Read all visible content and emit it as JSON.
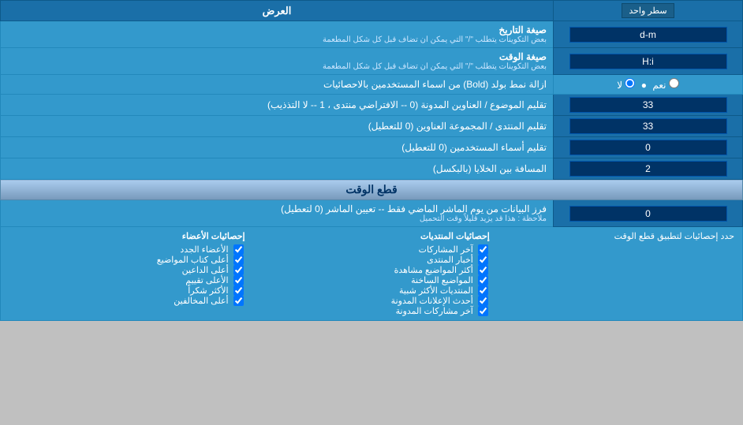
{
  "header": {
    "title": "العرض",
    "dropdown_label": "سطر واحد"
  },
  "rows": [
    {
      "id": "date_format",
      "label": "صيغة التاريخ",
      "sublabel": "بعض التكوينات يتطلب \"/\" التي يمكن ان تضاف قبل كل شكل المطعمة",
      "input_value": "d-m",
      "input_width": 200
    },
    {
      "id": "time_format",
      "label": "صيغة الوقت",
      "sublabel": "بعض التكوينات يتطلب \"/\" التي يمكن ان تضاف قبل كل شكل المطعمة",
      "input_value": "H:i",
      "input_width": 200
    }
  ],
  "bold_row": {
    "label": "ازالة نمط بولد (Bold) من اسماء المستخدمين بالاحصائيات",
    "option_yes": "نعم",
    "option_no": "لا",
    "selected": "no"
  },
  "topics_addresses": {
    "label": "تقليم الموضوع / العناوين المدونة (0 -- الافتراضي منتدى ، 1 -- لا التذذيب)",
    "value": "33"
  },
  "forum_addresses": {
    "label": "تقليم المنتدى / المجموعة العناوين (0 للتعطيل)",
    "value": "33"
  },
  "users_names": {
    "label": "تقليم أسماء المستخدمين (0 للتعطيل)",
    "value": "0"
  },
  "cells_distance": {
    "label": "المسافة بين الخلايا (بالبكسل)",
    "value": "2"
  },
  "cut_time_section": {
    "title": "قطع الوقت",
    "filter_label": "فرز البيانات من يوم الماشر الماضي فقط -- تعيين الماشر (0 لتعطيل)",
    "filter_note": "ملاحظة : هذا قد يزيد قليلاً وقت التحميل",
    "filter_value": "0"
  },
  "limit_section": {
    "label": "حدد إحصائيات لتطبيق قطع الوقت"
  },
  "checkboxes": {
    "col1_header": "إحصائيات الأعضاء",
    "col2_header": "إحصائيات المنتديات",
    "col1_items": [
      "الأعضاء الجدد",
      "أعلى كتاب المواضيع",
      "أعلى الداعين",
      "الأعلى تقييم",
      "الأكثر شكراً",
      "أعلى المخالفين"
    ],
    "col2_items": [
      "آخر المشاركات",
      "أخبار المنتدى",
      "أكثر المواضيع مشاهدة",
      "المواضيع الساخنة",
      "المنتديات الأكثر شبية",
      "أحدث الإعلانات المدونة",
      "آخر مشاركات المدونة"
    ]
  }
}
